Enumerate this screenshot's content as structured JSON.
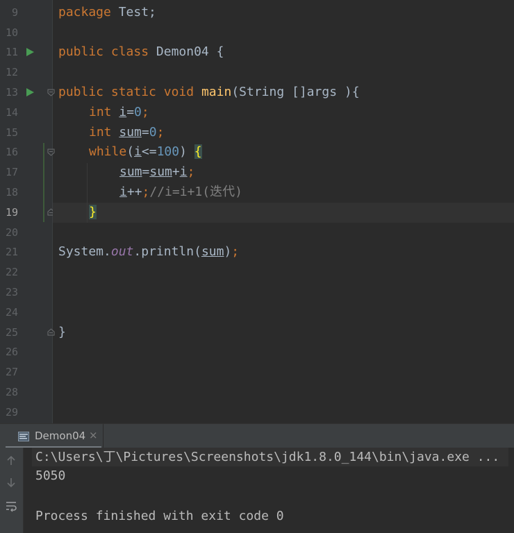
{
  "editor": {
    "line_numbers": [
      "9",
      "10",
      "11",
      "12",
      "13",
      "14",
      "15",
      "16",
      "17",
      "18",
      "19",
      "20",
      "21",
      "22",
      "23",
      "24",
      "25",
      "26",
      "27",
      "28",
      "29"
    ],
    "current_line": "19",
    "code": {
      "l9": {
        "kw": "package",
        "rest": " Test;"
      },
      "l11": {
        "kw1": "public",
        "kw2": "class",
        "name": " Demon04 {"
      },
      "l13": {
        "kw1": "public",
        "kw2": "static",
        "kw3": "void",
        "fn": "main",
        "params": "(String []args ){"
      },
      "l14": {
        "kw": "int",
        "var": "i",
        "eq": "=",
        "num": "0",
        "semi": ";"
      },
      "l15": {
        "kw": "int",
        "var": "sum",
        "eq": "=",
        "num": "0",
        "semi": ";"
      },
      "l16": {
        "kw": "while",
        "p1": "(",
        "var": "i",
        "op": "<=",
        "num": "100",
        "p2": ") ",
        "brace": "{"
      },
      "l17": {
        "a": "sum",
        "eq": "=",
        "b": "sum",
        "plus": "+",
        "c": "i",
        "semi": ";"
      },
      "l18": {
        "var": "i",
        "op": "++",
        "semi": ";",
        "comment": "//i=i+1(迭代)"
      },
      "l19": {
        "brace": "}"
      },
      "l21": {
        "cls": "System",
        "dot1": ".",
        "field": "out",
        "dot2": ".",
        "method": "println(",
        "arg": "sum",
        "close": ")",
        "semi": ";"
      },
      "l25": {
        "brace": "}"
      }
    }
  },
  "run_panel": {
    "tab_label": "Demon04",
    "close_glyph": "×",
    "console_lines": [
      "C:\\Users\\丁\\Pictures\\Screenshots\\jdk1.8.0_144\\bin\\java.exe ...",
      "5050",
      "",
      "Process finished with exit code 0"
    ]
  },
  "colors": {
    "background": "#2b2b2b",
    "keyword": "#cc7832",
    "number": "#6897bb",
    "method": "#ffc66d",
    "run_arrow": "#499c54"
  },
  "icons": [
    "run-arrow-icon",
    "fold-icon",
    "console-tab-icon",
    "close-icon",
    "scroll-up-icon",
    "scroll-down-icon",
    "soft-wrap-icon"
  ]
}
